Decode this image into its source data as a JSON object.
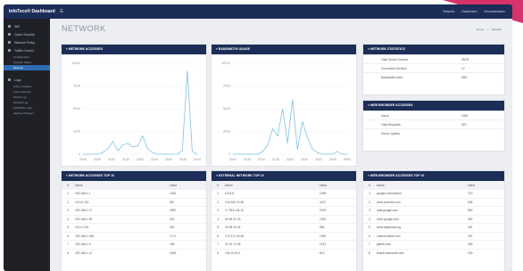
{
  "app": {
    "brand": "InfoTeco® Dashboard",
    "menu_icon": "hamburger-icon"
  },
  "topnav": [
    "Network",
    "Dashboard",
    "Documentation"
  ],
  "sidebar": {
    "items": [
      {
        "label": "Wifi",
        "icon": "wifi-icon"
      },
      {
        "label": "Cyber Security",
        "icon": "shield-icon"
      },
      {
        "label": "Network Policy",
        "icon": "policy-icon"
      },
      {
        "label": "Traffic Control",
        "icon": "traffic-icon",
        "expanded": true
      }
    ],
    "traffic_sub": [
      "Configuration",
      "Network Status",
      "Network"
    ],
    "items2": [
      {
        "label": "Logs",
        "icon": "logs-icon"
      }
    ],
    "logs_sub": [
      "Policy Violation",
      "Cyber Security",
      "DHCP Log",
      "Firewall Log",
      "NAPPING Logs",
      "Signing Changes"
    ],
    "active_sub": "Network"
  },
  "page": {
    "title": "NETWORK",
    "breadcrumbs": [
      "Home",
      "Network"
    ]
  },
  "panels": {
    "network_accesses": "» NETWORK ACCESSES",
    "bandwidth_usage": "» BANDWIDTH USAGE",
    "network_statistics": "» NETWORK STATISTICS",
    "web_browser_accesses": "» WEB BROWSER ACCESSES",
    "network_accesses_top": "» NETWORK ACCESSES TOP 10",
    "external_network_top": "» EXTERNAL NETWORK TOP 10",
    "web_browser_top": "» WEB BROWSER ACCESSES TOP 10"
  },
  "network_statistics": [
    {
      "k": "Total Online Devices",
      "v": "35/78"
    },
    {
      "k": "Connected Devices",
      "v": "12"
    },
    {
      "k": "Bandwidth Used",
      "v": "95%"
    }
  ],
  "web_browser": [
    {
      "k": "Users",
      "v": "1052"
    },
    {
      "k": "Total Requests",
      "v": "523"
    },
    {
      "k": "Server Uptime",
      "v": ""
    }
  ],
  "tables": {
    "headers": [
      "#",
      "Name",
      "Value"
    ],
    "network_top": [
      [
        "1",
        "192.168.1.1",
        "1044"
      ],
      [
        "2",
        "10.0.0.115",
        "857"
      ],
      [
        "3",
        "192.168.1.27",
        "2567"
      ],
      [
        "4",
        "192.168.1.99",
        "541"
      ],
      [
        "5",
        "10.0.1.201",
        "320"
      ],
      [
        "6",
        "192.168.1.156",
        "1771"
      ],
      [
        "7",
        "192.168.1.5",
        "166"
      ],
      [
        "8",
        "192.168.1.12",
        "1693"
      ]
    ],
    "external_top": [
      [
        "1",
        "8.8.8.8",
        "1265"
      ],
      [
        "2",
        "142.250.74.46",
        "4471"
      ],
      [
        "3",
        "17.253.144.10",
        "2023"
      ],
      [
        "4",
        "52.96.31.18",
        "1543"
      ],
      [
        "5",
        "40.99.10.34",
        "894"
      ],
      [
        "6",
        "172.217.16.46",
        "1390"
      ],
      [
        "7",
        "31.13.72.36",
        "1213"
      ],
      [
        "8",
        "104.16.50.1",
        "814"
      ]
    ],
    "browser_top": [
      [
        "1",
        "google.com/search",
        "719"
      ],
      [
        "2",
        "www.youtube.com",
        "635"
      ],
      [
        "3",
        "mail.google.com",
        "580"
      ],
      [
        "4",
        "drive.google.com",
        "452"
      ],
      [
        "5",
        "www.wikipedia.org",
        "301"
      ],
      [
        "6",
        "outlook.office.com",
        "297"
      ],
      [
        "7",
        "github.com",
        "260"
      ],
      [
        "8",
        "teams.microsoft.com",
        "233"
      ]
    ]
  },
  "chart_data": [
    {
      "type": "line",
      "title": "NETWORK ACCESSES",
      "x": [
        "20:00",
        "20:30",
        "21:00",
        "21:30",
        "22:00",
        "22:30",
        "23:00",
        "23:30",
        "00:00"
      ],
      "ylim": [
        0,
        100
      ],
      "y_ticks": [
        "0",
        "25.00",
        "50.00",
        "75.00",
        "100.00"
      ],
      "values": [
        0,
        0,
        0,
        0,
        2,
        6,
        14,
        4,
        10,
        12,
        8,
        9,
        20,
        6,
        2,
        0,
        0,
        0,
        0,
        0,
        4,
        92,
        3,
        0
      ],
      "color": "#7fc3e8"
    },
    {
      "type": "line",
      "title": "BANDWIDTH USAGE",
      "x": [
        "20:00",
        "20:30",
        "21:00",
        "21:30",
        "22:00",
        "22:30",
        "23:00",
        "23:30",
        "00:00"
      ],
      "ylim": [
        0,
        100
      ],
      "y_ticks": [
        "0",
        "25.00",
        "50.00",
        "75.00",
        "100.00"
      ],
      "values": [
        0,
        0,
        0,
        0,
        0,
        0,
        3,
        10,
        28,
        20,
        50,
        12,
        60,
        5,
        36,
        18,
        6,
        2,
        0,
        0,
        0,
        3,
        0,
        0
      ],
      "color": "#7fc3e8"
    }
  ],
  "colors": {
    "header": "#1c2d57",
    "sidebar": "#1f2127",
    "active": "#2f6db3",
    "accent": "#d6336c",
    "line": "#7fc3e8"
  }
}
